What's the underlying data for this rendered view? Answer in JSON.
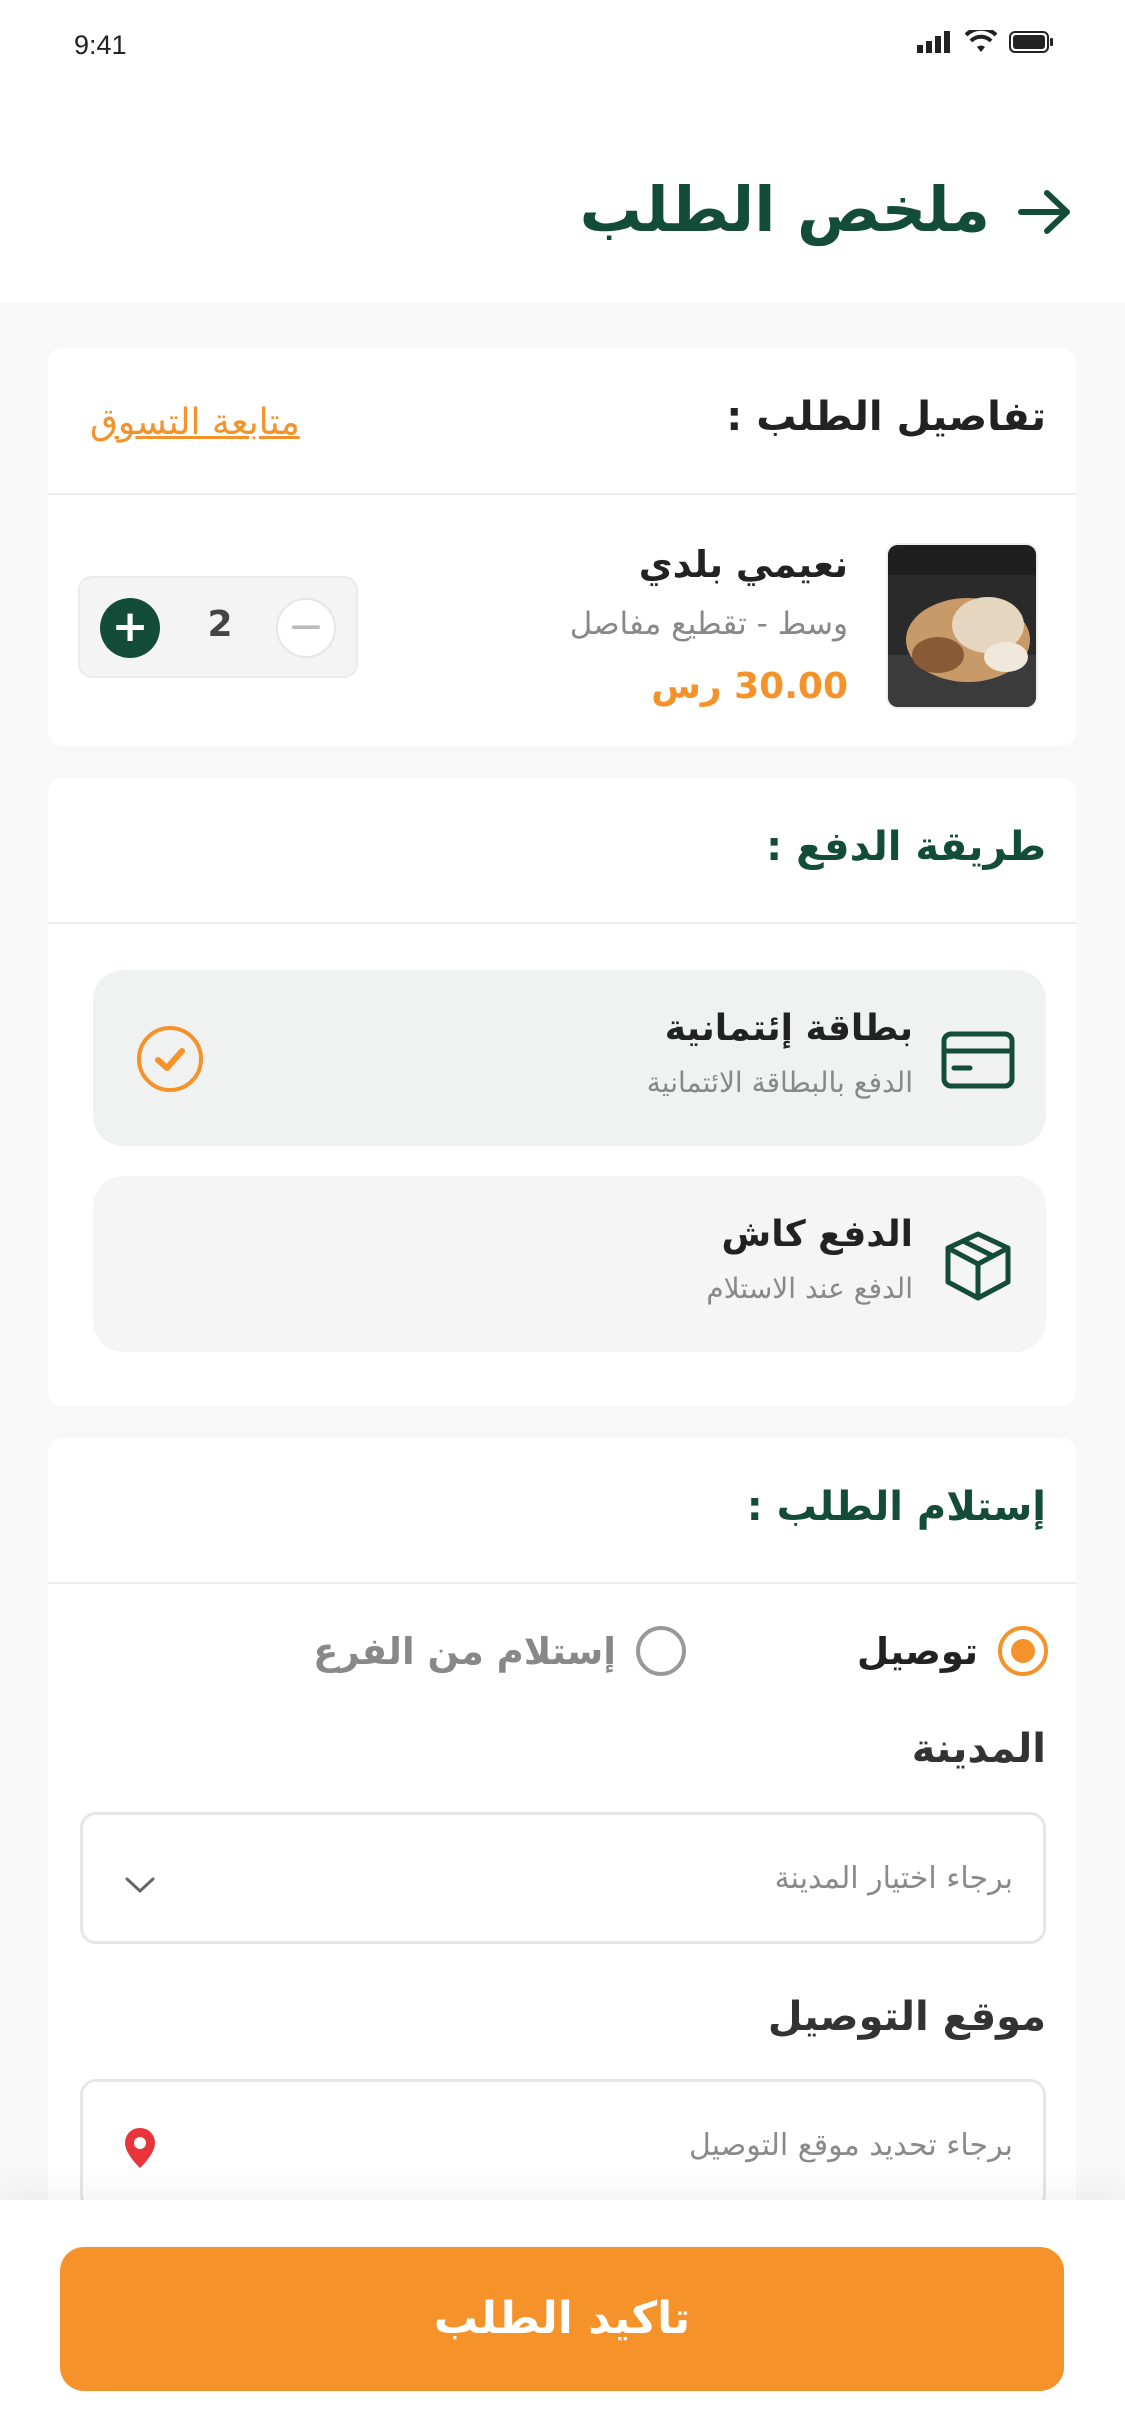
{
  "status_bar": {
    "time": "9:41",
    "icons": [
      "signal-icon",
      "wifi-icon",
      "battery-icon"
    ]
  },
  "header": {
    "title": "ملخص الطلب",
    "back_icon": "arrow-right-icon"
  },
  "order_details": {
    "title": "تفاصيل الطلب :",
    "continue_shopping": "متابعة التسوق",
    "item": {
      "name": "نعيمي بلدي",
      "variant": "وسط - تقطيع مفاصل",
      "price": "30.00 رس",
      "quantity": "2",
      "plus": "+",
      "minus": "−"
    }
  },
  "payment": {
    "title": "طريقة الدفع :",
    "options": [
      {
        "title": "بطاقة إئتمانية",
        "subtitle": "الدفع بالبطاقة الائتمانية",
        "icon": "credit-card-icon",
        "selected": true
      },
      {
        "title": "الدفع كاش",
        "subtitle": "الدفع عند الاستلام",
        "icon": "box-icon",
        "selected": false
      }
    ]
  },
  "receive": {
    "title": "إستلام الطلب :",
    "options": [
      {
        "label": "توصيل",
        "selected": true
      },
      {
        "label": "إستلام من الفرع",
        "selected": false
      }
    ],
    "city_label": "المدينة",
    "city_placeholder": "برجاء اختيار المدينة",
    "location_label": "موقع التوصيل",
    "location_placeholder": "برجاء تحديد موقع التوصيل"
  },
  "confirm_button": "تاكيد الطلب",
  "colors": {
    "primary": "#134d3a",
    "accent": "#f5922a",
    "background": "#f8f8f8"
  }
}
